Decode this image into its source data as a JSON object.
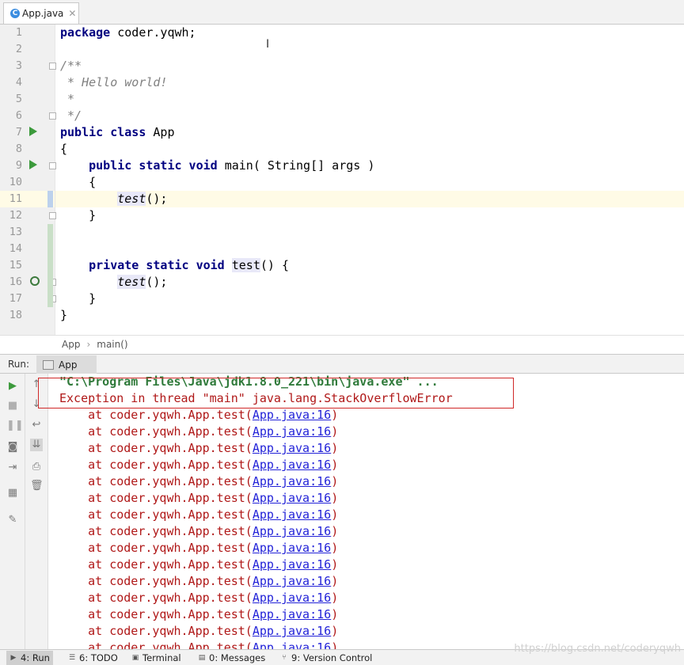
{
  "editor_tabs": [
    {
      "label": "App.java",
      "active": true
    }
  ],
  "editor": {
    "line_numbers": [
      "1",
      "2",
      "3",
      "4",
      "5",
      "6",
      "7",
      "8",
      "9",
      "10",
      "11",
      "12",
      "13",
      "14",
      "15",
      "16",
      "17",
      "18"
    ],
    "current_line": "11"
  },
  "breadcrumb": [
    "App",
    "main()"
  ],
  "run_window": {
    "title": "Run:",
    "tab_label": "App"
  },
  "console": {
    "command_line": "\"C:\\Program Files\\Java\\jdk1.8.0_221\\bin\\java.exe\" ...",
    "exception_line": "Exception in thread \"main\" java.lang.StackOverflowError",
    "stack_frame_prefix": "    at coder.yqwh.App.test(",
    "stack_frame_link": "App.java:16",
    "stack_frame_suffix": ")"
  },
  "bottom_tabs": [
    {
      "label": "4: Run",
      "icon": "run-icon",
      "active": true
    },
    {
      "label": "6: TODO",
      "icon": "todo-icon"
    },
    {
      "label": "Terminal",
      "icon": "terminal-icon"
    },
    {
      "label": "0: Messages",
      "icon": "messages-icon"
    },
    {
      "label": "9: Version Control",
      "icon": "vcs-icon"
    }
  ],
  "watermark": "https://blog.csdn.net/coderyqwh",
  "colors": {
    "keyword": "#000080",
    "comment": "#808080",
    "error_text": "#b01818",
    "command_text": "#2f7a3a",
    "link": "#2323d8",
    "highlight_box": "#d02828",
    "run_gutter_icon": "#3c9a3c"
  }
}
